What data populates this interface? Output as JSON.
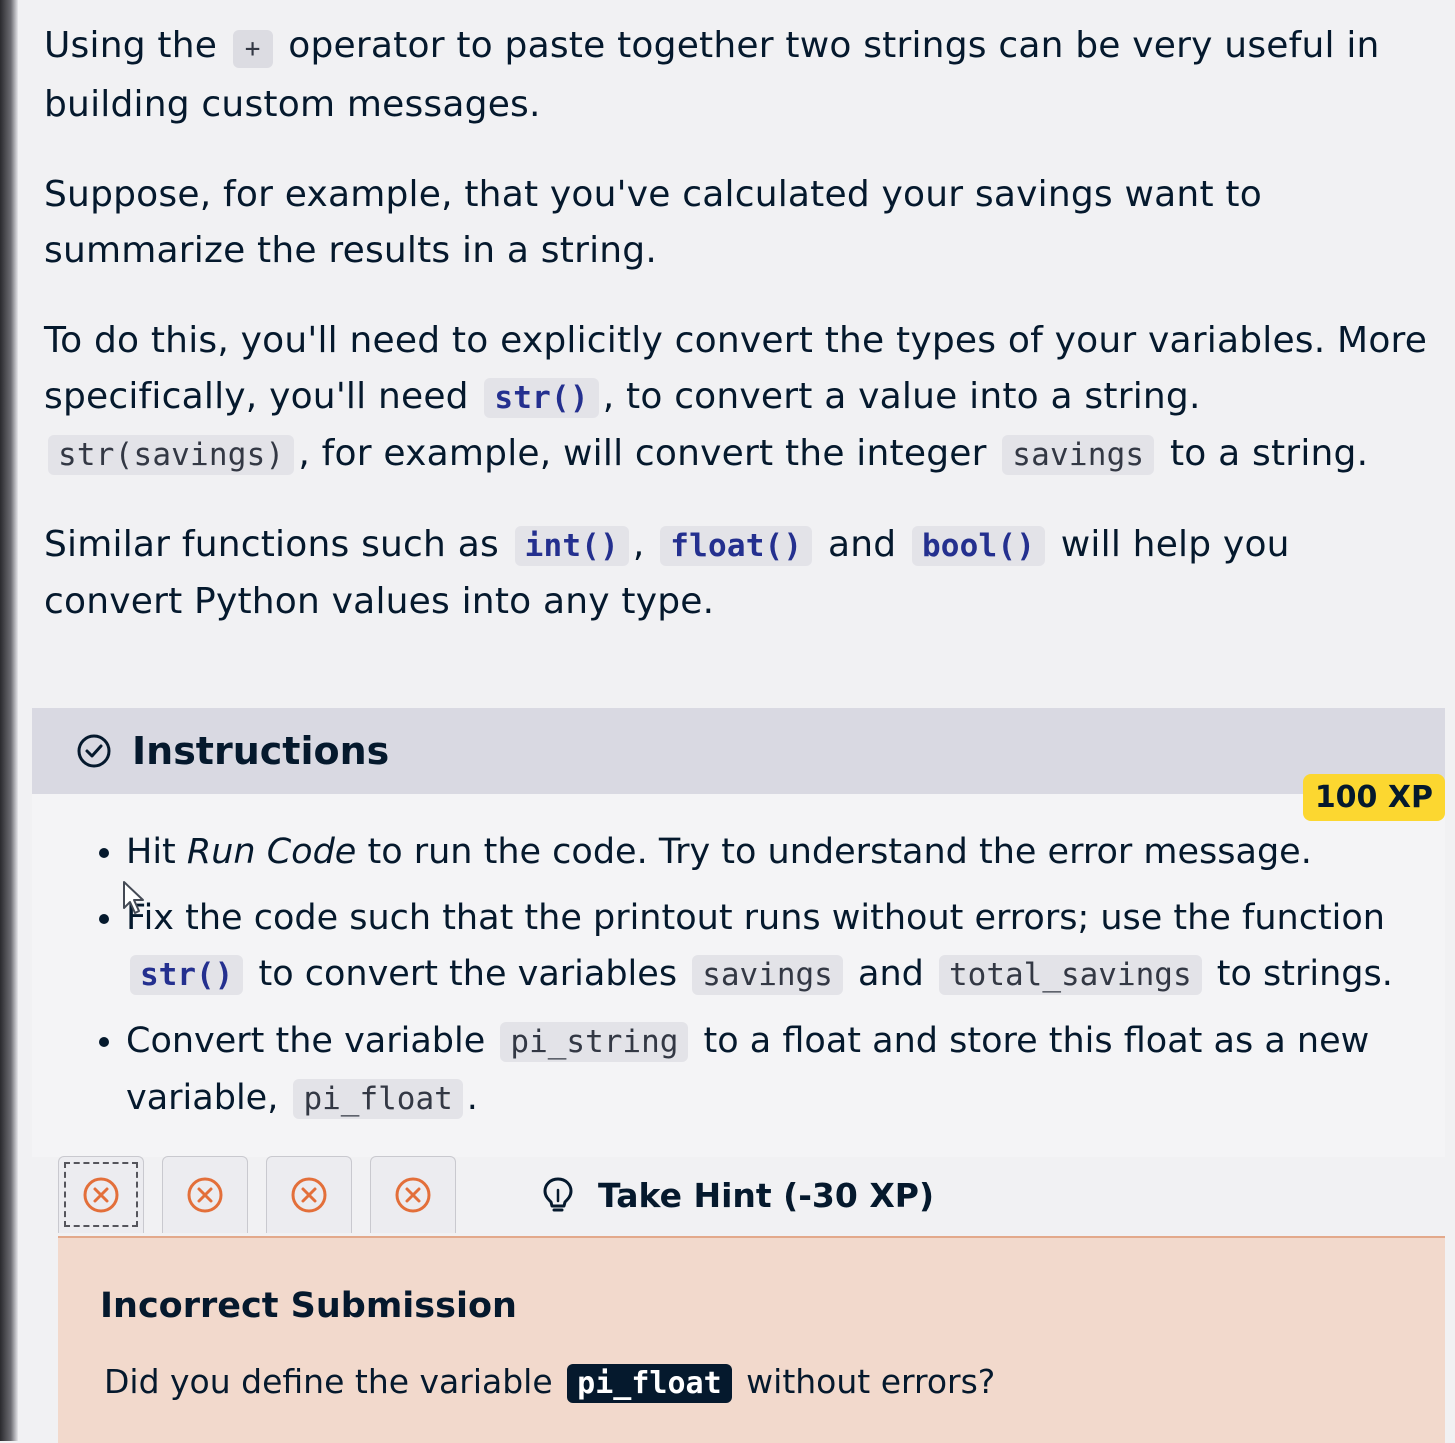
{
  "context": {
    "p1": {
      "a": "Using the",
      "code": "+",
      "b": "operator to paste together two strings can be very useful in building custom messages."
    },
    "p2": "Suppose, for example, that you've calculated your savings want to summarize the results in a string.",
    "p3": {
      "a": "To do this, you'll need to explicitly convert the types of your variables. More specifically, you'll need",
      "code1": "str()",
      "b": ", to convert a value into a string.",
      "code2": "str(savings)",
      "c": ", for example, will convert the integer",
      "code3": "savings",
      "d": "to a string."
    },
    "p4": {
      "a": "Similar functions such as",
      "code1": "int()",
      "sep1": ",",
      "code2": "float()",
      "and": "and",
      "code3": "bool()",
      "b": "will help you convert Python values into any type."
    }
  },
  "instructions": {
    "title": "Instructions",
    "xp": "100 XP",
    "items": [
      {
        "a": "Hit",
        "em": "Run Code",
        "b": "to run the code. Try to understand the error message."
      },
      {
        "a": "Fix the code such that the printout runs without errors; use the function",
        "code1": "str()",
        "b": "to convert the variables",
        "code2": "savings",
        "and": "and",
        "code3": "total_savings",
        "c": "to strings."
      },
      {
        "a": "Convert the variable",
        "code1": "pi_string",
        "b": "to a float and store this float as a new variable,",
        "code2": "pi_float",
        "c": "."
      }
    ]
  },
  "attempts": {
    "tabs": [
      {
        "icon": "x-circle-icon",
        "status": "incorrect",
        "active": true
      },
      {
        "icon": "x-circle-icon",
        "status": "incorrect",
        "active": false
      },
      {
        "icon": "x-circle-icon",
        "status": "incorrect",
        "active": false
      },
      {
        "icon": "x-circle-icon",
        "status": "incorrect",
        "active": false
      }
    ],
    "hint_label": "Take Hint (-30 XP)"
  },
  "feedback": {
    "title": "Incorrect Submission",
    "a": "Did you define the variable",
    "code": "pi_float",
    "b": "without errors?"
  },
  "colors": {
    "xp_badge": "#fcd730",
    "error": "#e36f3a",
    "feedback_bg": "#f2d9cc",
    "code_fn": "#24308f"
  }
}
